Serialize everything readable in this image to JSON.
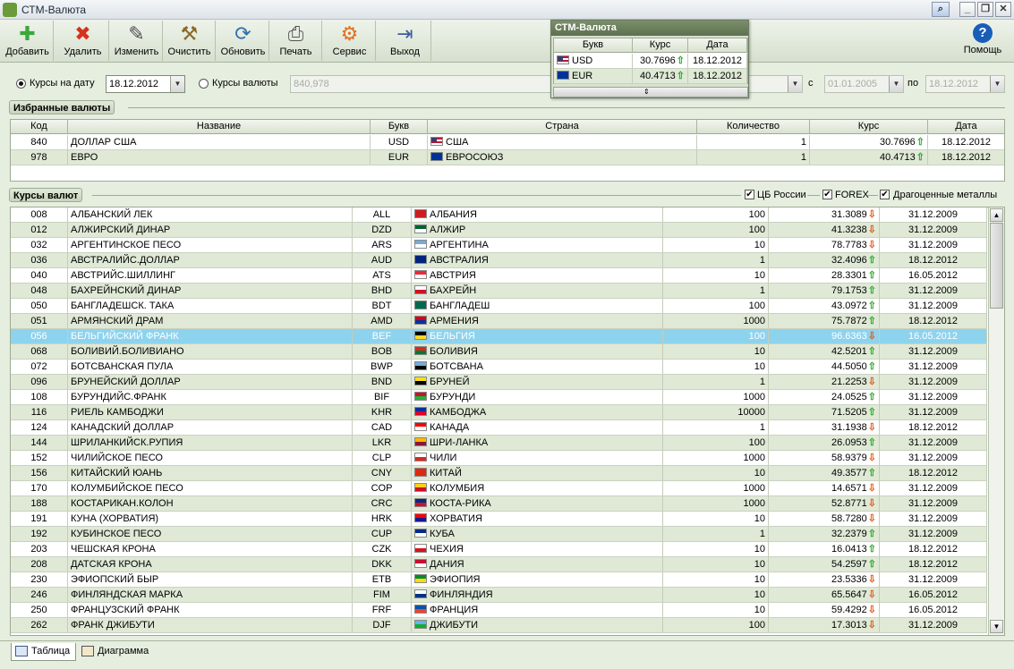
{
  "window": {
    "title": "СТМ-Валюта"
  },
  "toolbar": [
    {
      "label": "Добавить",
      "icon": "add-icon",
      "glyph": "✚",
      "color": "#3aa83a"
    },
    {
      "label": "Удалить",
      "icon": "delete-icon",
      "glyph": "✖",
      "color": "#d7321f"
    },
    {
      "label": "Изменить",
      "icon": "edit-icon",
      "glyph": "✎",
      "color": "#4d4d4d"
    },
    {
      "label": "Очистить",
      "icon": "broom-icon",
      "glyph": "⚒",
      "color": "#8a6a2a"
    },
    {
      "label": "Обновить",
      "icon": "globe-refresh-icon",
      "glyph": "⟳",
      "color": "#2b6fb0"
    },
    {
      "label": "Печать",
      "icon": "printer-icon",
      "glyph": "⎙",
      "color": "#555555"
    },
    {
      "label": "Сервис",
      "icon": "service-icon",
      "glyph": "⚙",
      "color": "#e07020"
    },
    {
      "label": "Выход",
      "icon": "exit-door-icon",
      "glyph": "⇥",
      "color": "#3a5fa0"
    },
    {
      "label": "Помощь",
      "icon": "help-icon",
      "glyph": "?",
      "color": "#1a5db8"
    }
  ],
  "filters": {
    "by_date_label": "Курсы на дату",
    "date_value": "18.12.2012",
    "by_currency_label": "Курсы валюты",
    "currency_value": "840,978",
    "from_label": "с",
    "from_value": "01.01.2005",
    "to_label": "по",
    "to_value": "18.12.2012"
  },
  "favorites": {
    "title": "Избранные валюты",
    "columns": [
      "Код",
      "Название",
      "Букв",
      "Страна",
      "Количество",
      "Курс",
      "Дата"
    ],
    "rows": [
      {
        "code": "840",
        "name": "ДОЛЛАР США",
        "letters": "USD",
        "country": "США",
        "qty": "1",
        "rate": "30.7696",
        "trend": "up",
        "date": "18.12.2012",
        "flag": "us"
      },
      {
        "code": "978",
        "name": "ЕВРО",
        "letters": "EUR",
        "country": "ЕВРОСОЮЗ",
        "qty": "1",
        "rate": "40.4713",
        "trend": "up",
        "date": "18.12.2012",
        "flag": "eu"
      }
    ]
  },
  "rates": {
    "title": "Курсы валют",
    "filter_cbr": "ЦБ России",
    "filter_forex": "FOREX",
    "filter_metals": "Драгоценные металлы",
    "rows": [
      {
        "code": "008",
        "name": "АЛБАНСКИЙ ЛЕК",
        "letters": "ALL",
        "country": "АЛБАНИЯ",
        "qty": "100",
        "rate": "31.3089",
        "trend": "down",
        "date": "31.12.2009",
        "flag": [
          "#d01c1f",
          "#d01c1f"
        ]
      },
      {
        "code": "012",
        "name": "АЛЖИРСКИЙ ДИНАР",
        "letters": "DZD",
        "country": "АЛЖИР",
        "qty": "100",
        "rate": "41.3238",
        "trend": "down",
        "date": "31.12.2009",
        "flag": [
          "#006233",
          "#ffffff"
        ]
      },
      {
        "code": "032",
        "name": "АРГЕНТИНСКОЕ ПЕСО",
        "letters": "ARS",
        "country": "АРГЕНТИНА",
        "qty": "10",
        "rate": "78.7783",
        "trend": "down",
        "date": "31.12.2009",
        "flag": [
          "#75aadb",
          "#ffffff"
        ]
      },
      {
        "code": "036",
        "name": "АВСТРАЛИЙС.ДОЛЛАР",
        "letters": "AUD",
        "country": "АВСТРАЛИЯ",
        "qty": "1",
        "rate": "32.4096",
        "trend": "up",
        "date": "18.12.2012",
        "flag": [
          "#00247d",
          "#00247d"
        ]
      },
      {
        "code": "040",
        "name": "АВСТРИЙС.ШИЛЛИНГ",
        "letters": "ATS",
        "country": "АВСТРИЯ",
        "qty": "10",
        "rate": "28.3301",
        "trend": "up",
        "date": "16.05.2012",
        "flag": [
          "#ed2939",
          "#ffffff"
        ]
      },
      {
        "code": "048",
        "name": "БАХРЕЙНСКИЙ ДИНАР",
        "letters": "BHD",
        "country": "БАХРЕЙН",
        "qty": "1",
        "rate": "79.1753",
        "trend": "up",
        "date": "31.12.2009",
        "flag": [
          "#ffffff",
          "#ce1126"
        ]
      },
      {
        "code": "050",
        "name": "БАНГЛАДЕШСК. ТАКА",
        "letters": "BDT",
        "country": "БАНГЛАДЕШ",
        "qty": "100",
        "rate": "43.0972",
        "trend": "up",
        "date": "31.12.2009",
        "flag": [
          "#006a4e",
          "#006a4e"
        ]
      },
      {
        "code": "051",
        "name": "АРМЯНСКИЙ ДРАМ",
        "letters": "AMD",
        "country": "АРМЕНИЯ",
        "qty": "1000",
        "rate": "75.7872",
        "trend": "up",
        "date": "18.12.2012",
        "flag": [
          "#d90012",
          "#0033a0"
        ]
      },
      {
        "code": "056",
        "name": "БЕЛЬГИЙСКИЙ ФРАНК",
        "letters": "BEF",
        "country": "БЕЛЬГИЯ",
        "qty": "100",
        "rate": "96.6363",
        "trend": "down",
        "date": "16.05.2012",
        "flag": [
          "#000000",
          "#fdda24"
        ]
      },
      {
        "code": "068",
        "name": "БОЛИВИЙ.БОЛИВИАНО",
        "letters": "BOB",
        "country": "БОЛИВИЯ",
        "qty": "10",
        "rate": "42.5201",
        "trend": "up",
        "date": "31.12.2009",
        "flag": [
          "#d52b1e",
          "#007934"
        ]
      },
      {
        "code": "072",
        "name": "БОТСВАНСКАЯ ПУЛА",
        "letters": "BWP",
        "country": "БОТСВАНА",
        "qty": "10",
        "rate": "44.5050",
        "trend": "up",
        "date": "31.12.2009",
        "flag": [
          "#75aadb",
          "#000000"
        ]
      },
      {
        "code": "096",
        "name": "БРУНЕЙСКИЙ ДОЛЛАР",
        "letters": "BND",
        "country": "БРУНЕЙ",
        "qty": "1",
        "rate": "21.2253",
        "trend": "down",
        "date": "31.12.2009",
        "flag": [
          "#f7e017",
          "#000000"
        ]
      },
      {
        "code": "108",
        "name": "БУРУНДИЙС.ФРАНК",
        "letters": "BIF",
        "country": "БУРУНДИ",
        "qty": "1000",
        "rate": "24.0525",
        "trend": "up",
        "date": "31.12.2009",
        "flag": [
          "#ce1126",
          "#1eb53a"
        ]
      },
      {
        "code": "116",
        "name": "РИЕЛЬ КАМБОДЖИ",
        "letters": "KHR",
        "country": "КАМБОДЖА",
        "qty": "10000",
        "rate": "71.5205",
        "trend": "up",
        "date": "31.12.2009",
        "flag": [
          "#032ea1",
          "#e00025"
        ]
      },
      {
        "code": "124",
        "name": "КАНАДСКИЙ ДОЛЛАР",
        "letters": "CAD",
        "country": "КАНАДА",
        "qty": "1",
        "rate": "31.1938",
        "trend": "down",
        "date": "18.12.2012",
        "flag": [
          "#ff0000",
          "#ffffff"
        ]
      },
      {
        "code": "144",
        "name": "ШРИЛАНКИЙСК.РУПИЯ",
        "letters": "LKR",
        "country": "ШРИ-ЛАНКА",
        "qty": "100",
        "rate": "26.0953",
        "trend": "up",
        "date": "31.12.2009",
        "flag": [
          "#ffb700",
          "#8d153a"
        ]
      },
      {
        "code": "152",
        "name": "ЧИЛИЙСКОЕ ПЕСО",
        "letters": "CLP",
        "country": "ЧИЛИ",
        "qty": "1000",
        "rate": "58.9379",
        "trend": "down",
        "date": "31.12.2009",
        "flag": [
          "#ffffff",
          "#d52b1e"
        ]
      },
      {
        "code": "156",
        "name": "КИТАЙСКИЙ ЮАНЬ",
        "letters": "CNY",
        "country": "КИТАЙ",
        "qty": "10",
        "rate": "49.3577",
        "trend": "up",
        "date": "18.12.2012",
        "flag": [
          "#de2910",
          "#de2910"
        ]
      },
      {
        "code": "170",
        "name": "КОЛУМБИЙСКОЕ ПЕСО",
        "letters": "COP",
        "country": "КОЛУМБИЯ",
        "qty": "1000",
        "rate": "14.6571",
        "trend": "down",
        "date": "31.12.2009",
        "flag": [
          "#fcd116",
          "#ce1126"
        ]
      },
      {
        "code": "188",
        "name": "КОСТАРИКАН.КОЛОН",
        "letters": "CRC",
        "country": "КОСТА-РИКА",
        "qty": "1000",
        "rate": "52.8771",
        "trend": "down",
        "date": "31.12.2009",
        "flag": [
          "#002b7f",
          "#ce1126"
        ]
      },
      {
        "code": "191",
        "name": "КУНА (ХОРВАТИЯ)",
        "letters": "HRK",
        "country": "ХОРВАТИЯ",
        "qty": "10",
        "rate": "58.7280",
        "trend": "down",
        "date": "31.12.2009",
        "flag": [
          "#ff0000",
          "#171796"
        ]
      },
      {
        "code": "192",
        "name": "КУБИНСКОЕ ПЕСО",
        "letters": "CUP",
        "country": "КУБА",
        "qty": "1",
        "rate": "32.2379",
        "trend": "up",
        "date": "31.12.2009",
        "flag": [
          "#002a8f",
          "#ffffff"
        ]
      },
      {
        "code": "203",
        "name": "ЧЕШСКАЯ КРОНА",
        "letters": "CZK",
        "country": "ЧЕХИЯ",
        "qty": "10",
        "rate": "16.0413",
        "trend": "up",
        "date": "18.12.2012",
        "flag": [
          "#ffffff",
          "#d7141a"
        ]
      },
      {
        "code": "208",
        "name": "ДАТСКАЯ КРОНА",
        "letters": "DKK",
        "country": "ДАНИЯ",
        "qty": "10",
        "rate": "54.2597",
        "trend": "up",
        "date": "18.12.2012",
        "flag": [
          "#c60c30",
          "#ffffff"
        ]
      },
      {
        "code": "230",
        "name": "ЭФИОПСКИЙ БЫР",
        "letters": "ETB",
        "country": "ЭФИОПИЯ",
        "qty": "10",
        "rate": "23.5336",
        "trend": "down",
        "date": "31.12.2009",
        "flag": [
          "#078930",
          "#fcdd09"
        ]
      },
      {
        "code": "246",
        "name": "ФИНЛЯНДСКАЯ МАРКА",
        "letters": "FIM",
        "country": "ФИНЛЯНДИЯ",
        "qty": "10",
        "rate": "65.5647",
        "trend": "down",
        "date": "16.05.2012",
        "flag": [
          "#ffffff",
          "#003580"
        ]
      },
      {
        "code": "250",
        "name": "ФРАНЦУЗСКИЙ ФРАНК",
        "letters": "FRF",
        "country": "ФРАНЦИЯ",
        "qty": "10",
        "rate": "59.4292",
        "trend": "down",
        "date": "16.05.2012",
        "flag": [
          "#0055a4",
          "#ef4135"
        ]
      },
      {
        "code": "262",
        "name": "ФРАНК ДЖИБУТИ",
        "letters": "DJF",
        "country": "ДЖИБУТИ",
        "qty": "100",
        "rate": "17.3013",
        "trend": "down",
        "date": "31.12.2009",
        "flag": [
          "#6ab2e7",
          "#12ad2b"
        ]
      }
    ]
  },
  "popup": {
    "title": "СТМ-Валюта",
    "columns": [
      "Букв",
      "Курс",
      "Дата"
    ],
    "rows": [
      {
        "letters": "USD",
        "rate": "30.7696",
        "trend": "up",
        "date": "18.12.2012",
        "flag": "us"
      },
      {
        "letters": "EUR",
        "rate": "40.4713",
        "trend": "up",
        "date": "18.12.2012",
        "flag": "eu"
      }
    ]
  },
  "tabs": [
    {
      "label": "Таблица",
      "active": true
    },
    {
      "label": "Диаграмма",
      "active": false
    }
  ]
}
